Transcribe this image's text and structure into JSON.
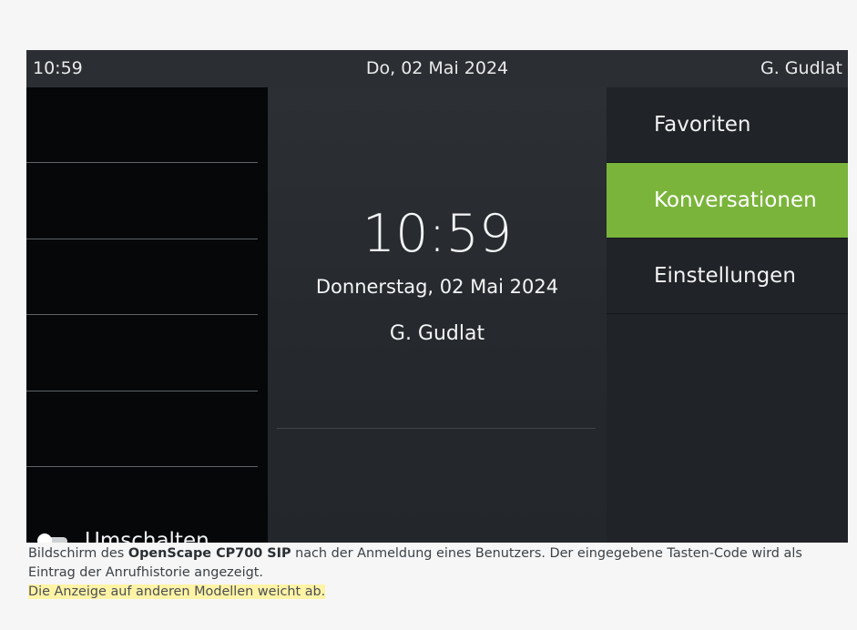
{
  "statusbar": {
    "time": "10:59",
    "date": "Do, 02 Mai 2024",
    "user": "G. Gudlat"
  },
  "left_panel": {
    "toggle_label": "Umschalten"
  },
  "center": {
    "time": "10:59",
    "long_date": "Donnerstag, 02 Mai 2024",
    "user": "G. Gudlat"
  },
  "menu": {
    "items": [
      {
        "label": "Favoriten",
        "active": false
      },
      {
        "label": "Konversationen",
        "active": true
      },
      {
        "label": "Einstellungen",
        "active": false
      }
    ]
  },
  "caption": {
    "prefix": "Bildschirm des ",
    "model": "OpenScape CP700 SIP",
    "suffix": " nach der Anmeldung eines Benutzers. Der eingegebene Tasten-Code wird als Eintrag der Anrufhistorie angezeigt.",
    "note": "Die Anzeige auf anderen Modellen weicht ab."
  },
  "colors": {
    "accent": "#7ab43b",
    "statusbar_bg": "#2b2e32",
    "left_bg": "#050709",
    "highlight": "#fff3a6"
  }
}
